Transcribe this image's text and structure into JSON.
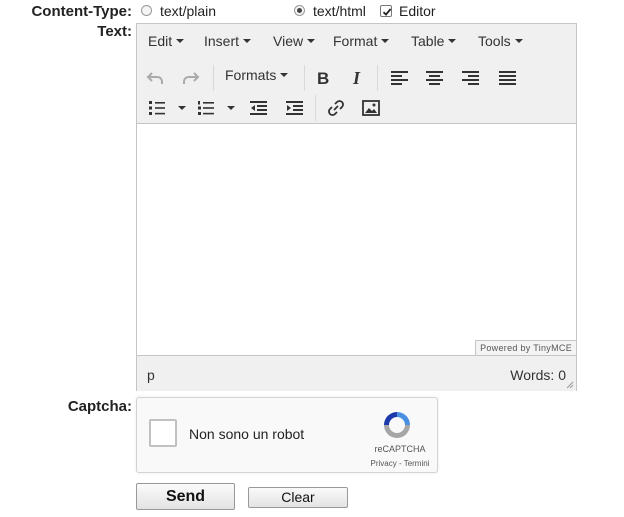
{
  "content_type": {
    "label": "Content-Type:",
    "options": [
      {
        "label": "text/plain",
        "selected": false
      },
      {
        "label": "text/html",
        "selected": true
      }
    ],
    "editor_label": "Editor",
    "editor_checked": true
  },
  "text_field": {
    "label": "Text:",
    "menubar": [
      "Edit",
      "Insert",
      "View",
      "Format",
      "Table",
      "Tools"
    ],
    "toolbar": {
      "formats_label": "Formats",
      "icons": [
        "undo-icon",
        "redo-icon",
        "bold-icon",
        "italic-icon",
        "align-left-icon",
        "align-center-icon",
        "align-right-icon",
        "align-justify-icon",
        "bullet-list-icon",
        "numbered-list-icon",
        "outdent-icon",
        "indent-icon",
        "link-icon",
        "image-icon"
      ]
    },
    "content": "",
    "powered_by": "Powered by TinyMCE",
    "status_path": "p",
    "word_count": "Words: 0"
  },
  "captcha": {
    "label": "Captcha:",
    "checkbox_text": "Non sono un robot",
    "brand": "reCAPTCHA",
    "links": "Privacy - Termini"
  },
  "buttons": {
    "send": "Send",
    "clear": "Clear"
  },
  "colors": {
    "toolbar_bg": "#f0f0f0",
    "border": "#c5c5c5",
    "recaptcha_blue": "#4a90e2"
  }
}
